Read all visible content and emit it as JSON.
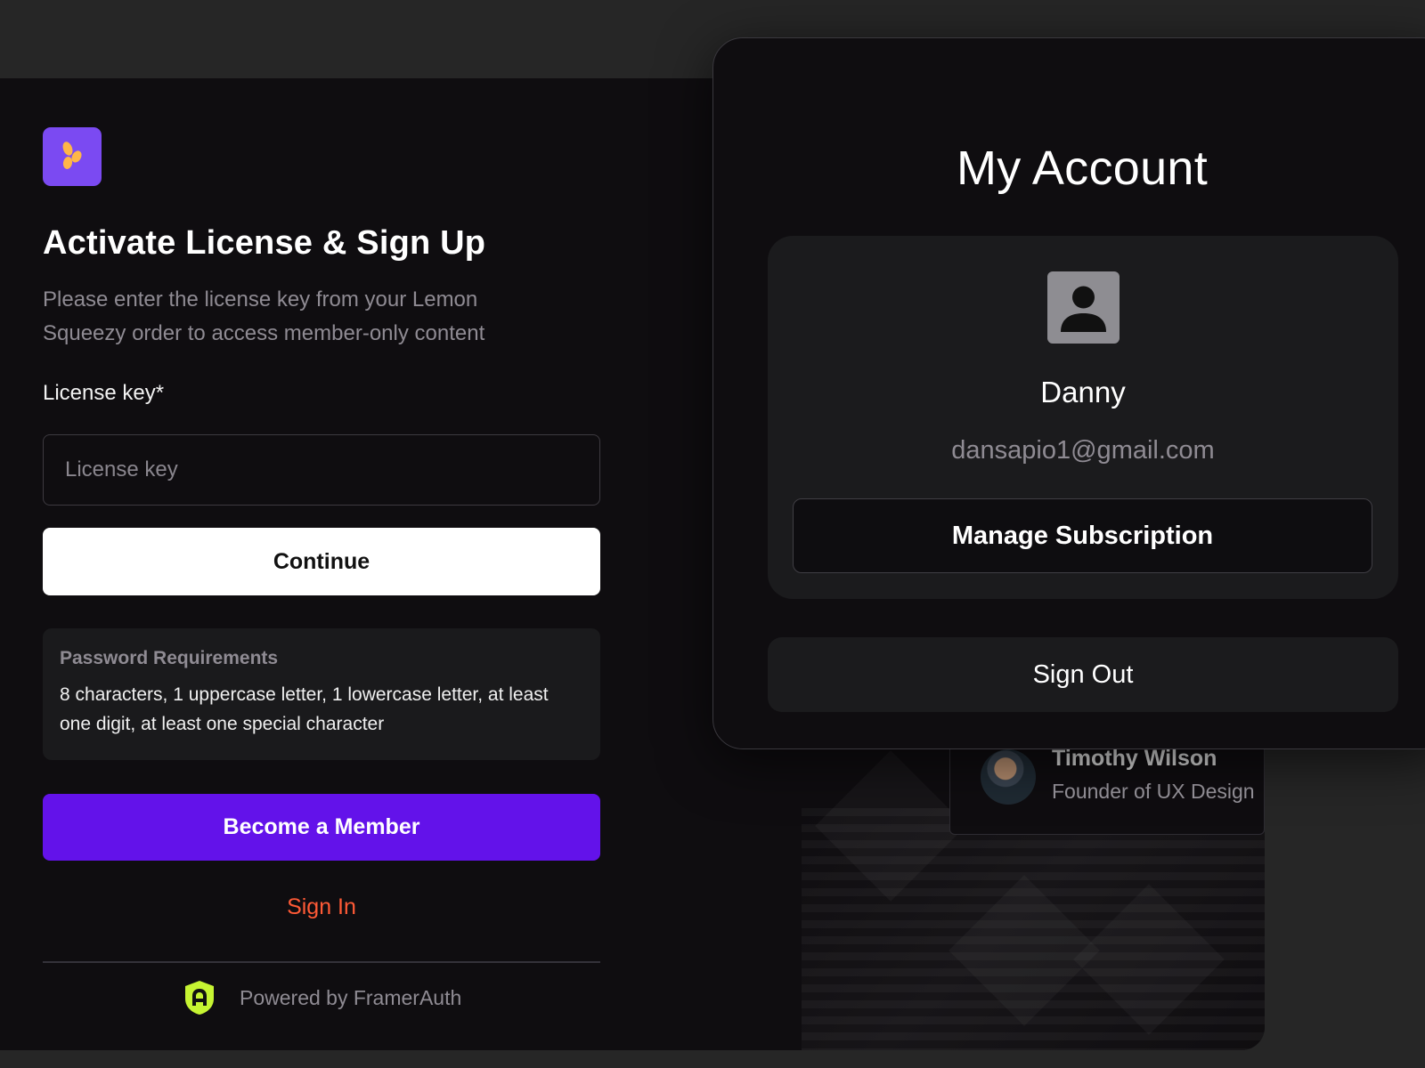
{
  "signup": {
    "title": "Activate License & Sign Up",
    "subtitle": "Please enter the license key from your Lemon Squeezy order to access member-only content",
    "license_label": "License key*",
    "license_placeholder": "License key",
    "license_value": "",
    "continue_label": "Continue",
    "password_requirements": {
      "title": "Password Requirements",
      "text": "8 characters, 1 uppercase letter, 1 lowercase letter, at least one digit, at least one special character"
    },
    "become_member_label": "Become a Member",
    "sign_in_label": "Sign In",
    "powered_by": "Powered by FramerAuth"
  },
  "testimonial": {
    "name": "Timothy Wilson",
    "role": "Founder of UX Design"
  },
  "account": {
    "title": "My Account",
    "user_name": "Danny",
    "email": "dansapio1@gmail.com",
    "manage_label": "Manage Subscription",
    "sign_out_label": "Sign Out"
  },
  "icons": {
    "logo": "lemon-squeezy-logo-icon",
    "profile": "user-placeholder-icon",
    "powered": "framerauth-shield-icon"
  },
  "colors": {
    "page_background": "#262626",
    "panel_background": "#0f0d10",
    "logo_background": "#7b4af2",
    "logo_mark": "#ffb648",
    "member_button": "#6312ea",
    "sign_in_link": "#ff5a36",
    "framerauth_badge": "#c6f432"
  }
}
